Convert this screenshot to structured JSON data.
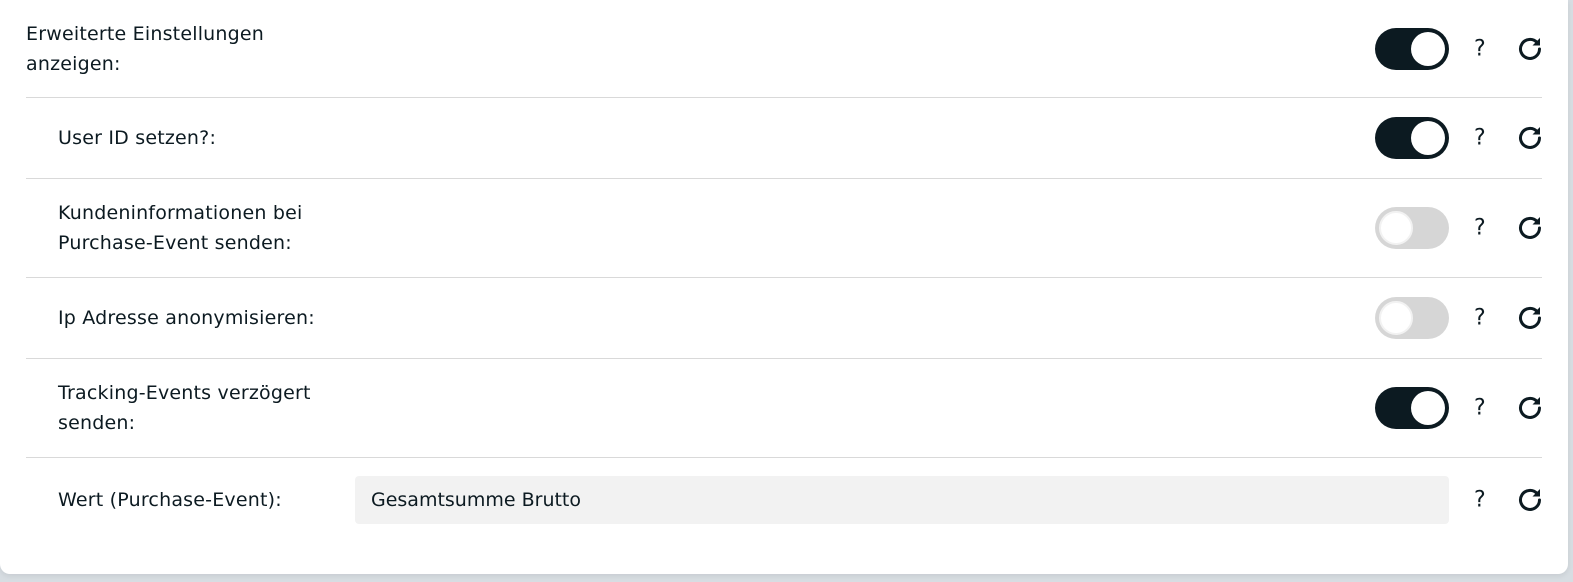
{
  "settings": {
    "rows": [
      {
        "label": "Erweiterte Einstellungen anzeigen:",
        "toggle": true
      },
      {
        "label": "User ID setzen?:",
        "toggle": true
      },
      {
        "label": "Kundeninformationen bei Purchase-Event senden:",
        "toggle": false
      },
      {
        "label": "Ip Adresse anonymisieren:",
        "toggle": false
      },
      {
        "label": "Tracking-Events verzögert senden:",
        "toggle": true
      },
      {
        "label": "Wert (Purchase-Event):",
        "value": "Gesamtsumme Brutto"
      }
    ],
    "help_label": "?"
  },
  "icons": {
    "help": "question-mark-icon",
    "reset": "reset-icon"
  },
  "colors": {
    "toggle_on": "#0c1a21",
    "toggle_off": "#d6d6d6",
    "input_bg": "#f2f2f2",
    "text": "#0c1a21"
  }
}
